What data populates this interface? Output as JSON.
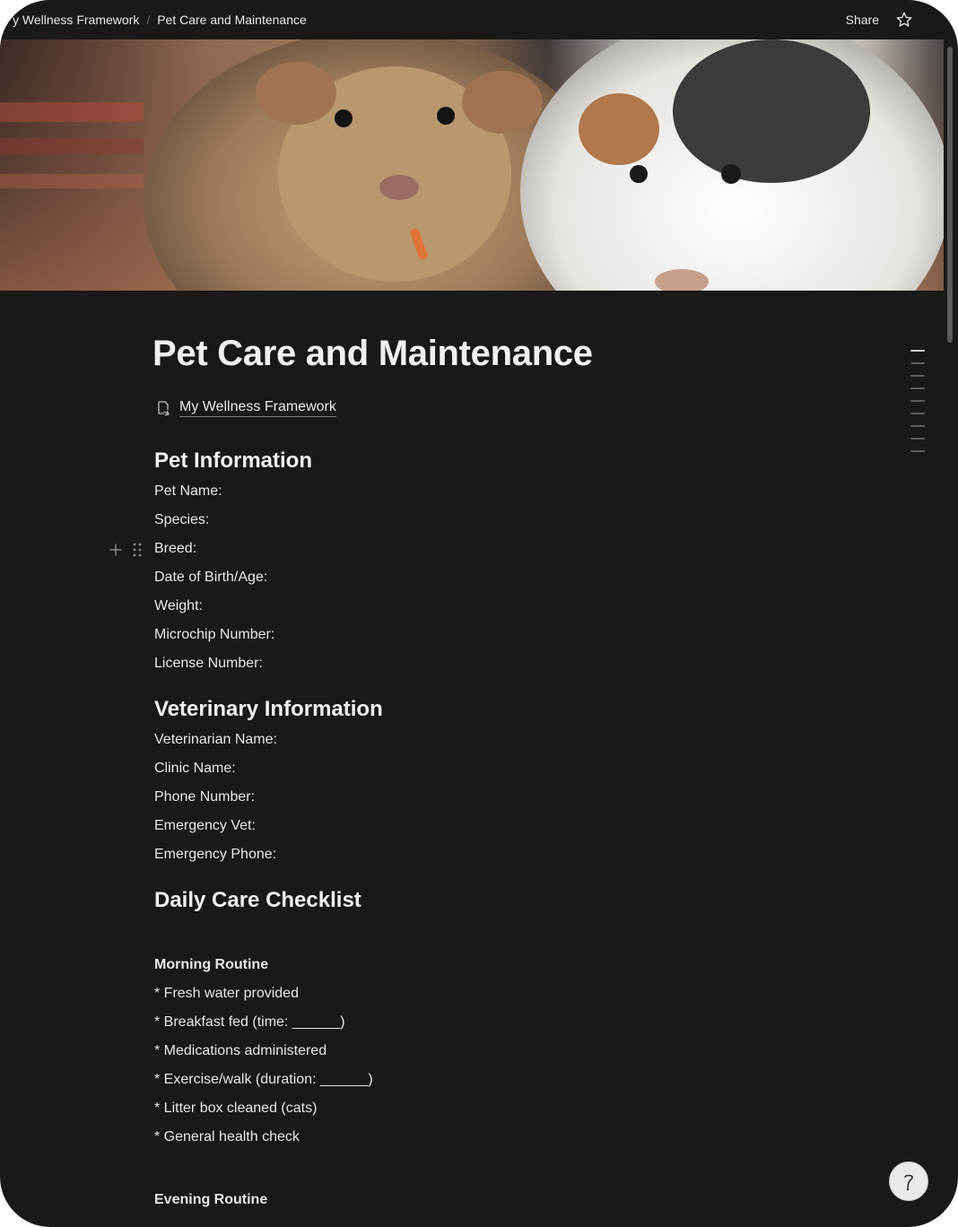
{
  "topbar": {
    "breadcrumbs": [
      "y Wellness Framework",
      "Pet Care and Maintenance"
    ],
    "separator": "/",
    "share_label": "Share"
  },
  "page": {
    "title": "Pet Care and Maintenance",
    "parent_link": "My Wellness Framework"
  },
  "sections": {
    "pet_info": {
      "heading": "Pet Information",
      "fields": [
        "Pet Name:",
        "Species:",
        "Breed:",
        "Date of Birth/Age:",
        "Weight:",
        "Microchip Number:",
        "License Number:"
      ]
    },
    "vet_info": {
      "heading": "Veterinary Information",
      "fields": [
        "Veterinarian Name:",
        "Clinic Name:",
        "Phone Number:",
        "Emergency Vet:",
        "Emergency Phone:"
      ]
    },
    "daily_care": {
      "heading": "Daily Care Checklist",
      "morning_heading": "Morning Routine",
      "morning_items": [
        "* Fresh water provided",
        "* Breakfast fed (time: ______)",
        "* Medications administered",
        "* Exercise/walk (duration: ______)",
        "* Litter box cleaned (cats)",
        "* General health check"
      ],
      "evening_heading": "Evening Routine"
    }
  },
  "icons": {
    "star": "star-icon",
    "page": "page-link-icon",
    "add": "plus-icon",
    "drag": "drag-handle-icon",
    "help": "help-icon"
  },
  "colors": {
    "background": "#191919",
    "text": "#e6e6e6",
    "heading": "#f0f0f0"
  }
}
